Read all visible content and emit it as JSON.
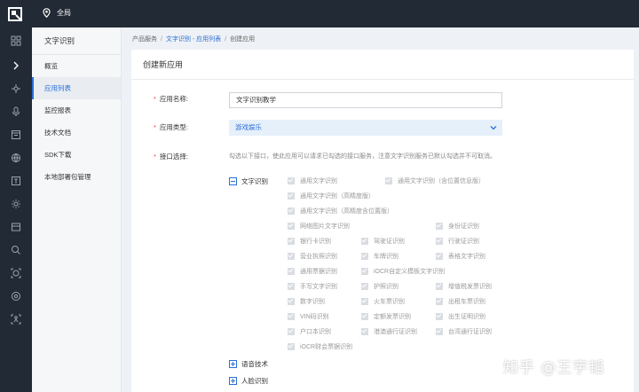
{
  "topbar": {
    "region": "全局"
  },
  "sidenav": {
    "title": "文字识别",
    "items": [
      "概览",
      "应用列表",
      "监控报表",
      "技术文档",
      "SDK下载",
      "本地部署包管理"
    ]
  },
  "breadcrumb": {
    "root": "产品服务",
    "link": "文字识别 - 应用列表",
    "current": "创建应用"
  },
  "form": {
    "title": "创建新应用",
    "name_label": "应用名称:",
    "name_value": "文字识别教学",
    "type_label": "应用类型:",
    "type_value": "游戏娱乐",
    "api_label": "接口选择:",
    "hint": "勾选以下接口，使此应用可以请求已勾选的接口服务，注意文字识别服务已默认勾选并不可取消。",
    "groups": {
      "ocr": "文字识别",
      "speech": "语音技术",
      "face": "人脸识别"
    },
    "apis": [
      "通用文字识别",
      "通用文字识别（含位置信息版）",
      "通用文字识别（高精度版）",
      "通用文字识别（高精度含位置版）",
      "网络图片文字识别",
      "身份证识别",
      "银行卡识别",
      "驾驶证识别",
      "行驶证识别",
      "营业执照识别",
      "车牌识别",
      "表格文字识别",
      "通用票据识别",
      "iOCR自定义模板文字识别",
      "手写文字识别",
      "护照识别",
      "增值税发票识别",
      "数字识别",
      "火车票识别",
      "出租车票识别",
      "VIN码识别",
      "定额发票识别",
      "出生证明识别",
      "户口本识别",
      "港澳通行证识别",
      "台湾通行证识别",
      "iOCR财会票据识别"
    ]
  },
  "watermark": "知乎 @王宇韬"
}
